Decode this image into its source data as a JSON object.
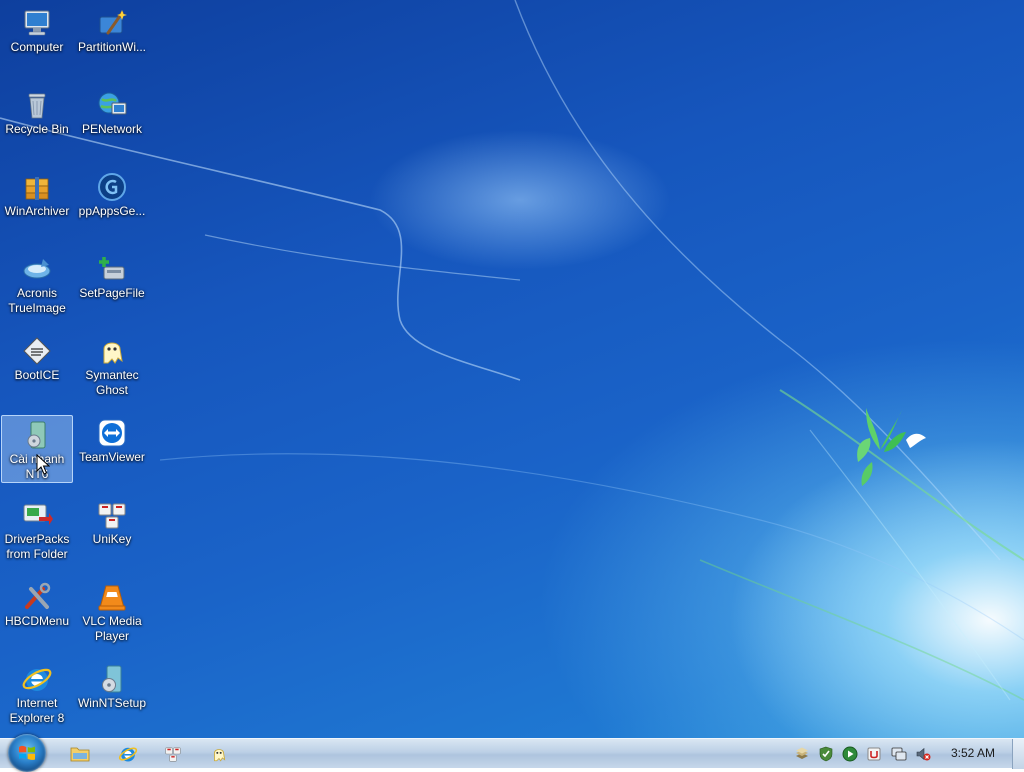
{
  "desktop": {
    "icons": [
      {
        "label": "Computer",
        "icon": "computer-icon"
      },
      {
        "label": "PartitionWi...",
        "icon": "partition-wizard-icon"
      },
      {
        "label": "Recycle Bin",
        "icon": "recycle-bin-icon"
      },
      {
        "label": "PENetwork",
        "icon": "network-icon"
      },
      {
        "label": "WinArchiver",
        "icon": "archiver-icon"
      },
      {
        "label": "ppAppsGe...",
        "icon": "ppapps-icon"
      },
      {
        "label": "Acronis TrueImage",
        "icon": "acronis-icon"
      },
      {
        "label": "SetPageFile",
        "icon": "setpagefile-icon"
      },
      {
        "label": "BootICE",
        "icon": "bootice-icon"
      },
      {
        "label": "Symantec Ghost",
        "icon": "ghost-icon"
      },
      {
        "label": "Cài nhanh NT6",
        "icon": "installer-icon",
        "selected": true
      },
      {
        "label": "TeamViewer",
        "icon": "teamviewer-icon"
      },
      {
        "label": "DriverPacks from Folder",
        "icon": "driverpacks-icon"
      },
      {
        "label": "UniKey",
        "icon": "unikey-icon"
      },
      {
        "label": "HBCDMenu",
        "icon": "hbcd-tools-icon"
      },
      {
        "label": "VLC Media Player",
        "icon": "vlc-icon"
      },
      {
        "label": "Internet Explorer 8",
        "icon": "internet-explorer-icon"
      },
      {
        "label": "WinNTSetup",
        "icon": "winntsetup-icon"
      }
    ]
  },
  "taskbar": {
    "start_icon": "windows-logo-icon",
    "pinned": [
      {
        "name": "explorer",
        "icon": "folder-icon"
      },
      {
        "name": "internet-explorer",
        "icon": "internet-explorer-icon"
      },
      {
        "name": "unikey",
        "icon": "unikey-icon"
      },
      {
        "name": "ghost",
        "icon": "ghost-icon"
      }
    ],
    "tray": [
      {
        "name": "stack",
        "icon": "stack-icon"
      },
      {
        "name": "shield",
        "icon": "shield-check-icon"
      },
      {
        "name": "media",
        "icon": "play-icon"
      },
      {
        "name": "unikey",
        "icon": "unikey-tray-icon"
      },
      {
        "name": "network",
        "icon": "network-monitor-icon"
      },
      {
        "name": "volume",
        "icon": "volume-muted-icon"
      }
    ],
    "clock": "3:52 AM"
  }
}
